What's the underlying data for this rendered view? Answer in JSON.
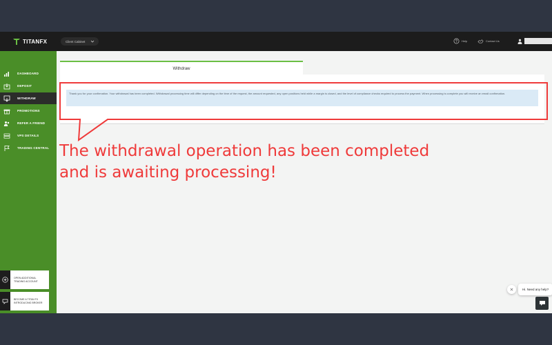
{
  "topbar": {
    "logo_text": "TITANFX",
    "cabinet_label": "Client Cabinet",
    "help_label": "Help",
    "contact_label": "Contact Us"
  },
  "sidebar": {
    "items": [
      {
        "label": "DASHBOARD",
        "icon": "bar-chart-icon",
        "active": false
      },
      {
        "label": "DEPOSIT",
        "icon": "deposit-icon",
        "active": false
      },
      {
        "label": "WITHDRAW",
        "icon": "withdraw-icon",
        "active": true
      },
      {
        "label": "PROMOTIONS",
        "icon": "gift-icon",
        "active": false
      },
      {
        "label": "REFER A FRIEND",
        "icon": "refer-icon",
        "active": false
      },
      {
        "label": "VPS DETAILS",
        "icon": "server-icon",
        "active": false
      },
      {
        "label": "TRADING CENTRAL",
        "icon": "flag-icon",
        "active": false
      }
    ],
    "promos": [
      {
        "text": "OPEN ADDITIONAL\nTRADING ACCOUNT",
        "icon": "plus-circle-icon"
      },
      {
        "text": "BECOME A TITAN FX\nINTRODUCING BROKER",
        "icon": "handshake-icon"
      }
    ]
  },
  "main": {
    "tab_label": "Withdraw",
    "alert_text": "Thank you for your confirmation. Your withdrawal has been completed. Withdrawal processing time will differ depending on the time of the request, the amount requested, any open positions held while a margin is closed, and the level of compliance checks required to process the payment. When processing is complete you will receive an email confirmation."
  },
  "callout": {
    "line1": "The withdrawal operation has been completed",
    "line2": "and is awaiting processing!",
    "color": "#ef3a3a"
  },
  "chat": {
    "bubble_text": "Hi. Need any help?"
  },
  "colors": {
    "sidebar": "#4a8e28",
    "topbar": "#1c1c1c",
    "accent": "#6bbf44",
    "alert_bg": "#daeaf6"
  }
}
